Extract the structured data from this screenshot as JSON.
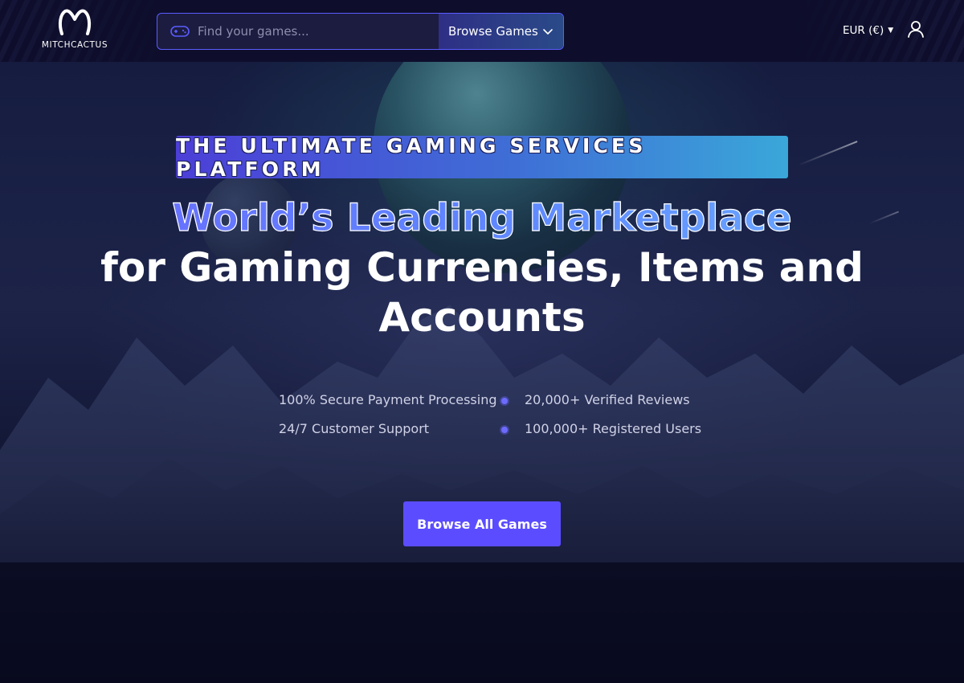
{
  "header": {
    "brand": "MITCHCACTUS",
    "search": {
      "placeholder": "Find your games...",
      "value": ""
    },
    "browse_dropdown_label": "Browse Games",
    "currency_label": "EUR (€)"
  },
  "hero": {
    "tagline": "THE ULTIMATE GAMING SERVICES PLATFORM",
    "headline_line1": "World’s Leading Marketplace",
    "headline_line2": "for Gaming Currencies, Items and Accounts",
    "features": [
      "100% Secure Payment Processing",
      "20,000+ Verified Reviews",
      "24/7 Customer Support",
      "100,000+ Registered Users"
    ],
    "cta_label": "Browse All Games"
  },
  "icons": {
    "logo": "mitchcactus-logo-icon",
    "search": "gamepad-icon",
    "dropdown": "chevron-down-icon",
    "currency": "caret-down-icon",
    "user": "user-icon"
  },
  "colors": {
    "accent": "#5b4dff",
    "header_bg": "#0e0e2c",
    "headline_gradient_start": "#6a67ff",
    "headline_gradient_end": "#6db2ff",
    "tagline_gradient_start": "#4c3fd7",
    "tagline_gradient_end": "#3aa7d9"
  }
}
